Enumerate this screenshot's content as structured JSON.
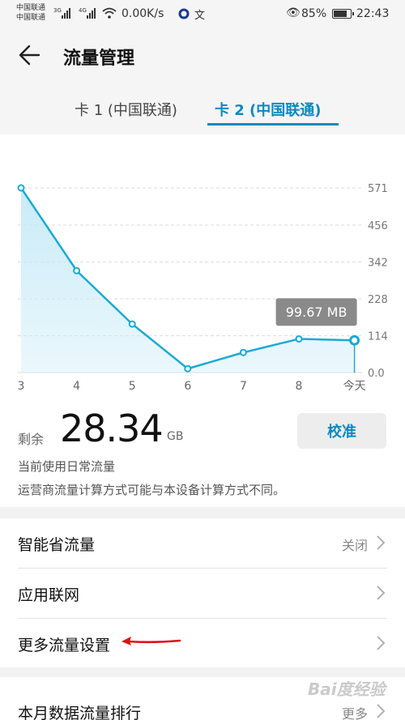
{
  "status_bar": {
    "carrier1": "中国联通",
    "carrier2": "中国联通",
    "sig1": "3G",
    "sig2": "4G",
    "speed": "0.00K/s",
    "extra": "文",
    "battery": "85%",
    "battery_level": 0.85,
    "time": "22:43"
  },
  "header": {
    "title": "流量管理",
    "tabs": [
      {
        "label": "卡 1 (中国联通)",
        "active": false
      },
      {
        "label": "卡 2 (中国联通)",
        "active": true
      }
    ]
  },
  "chart_data": {
    "type": "area",
    "categories": [
      "3",
      "4",
      "5",
      "6",
      "7",
      "8",
      "今天"
    ],
    "values": [
      571,
      315,
      150,
      12,
      62,
      104,
      99.67
    ],
    "ylim": [
      0,
      571
    ],
    "yticks": [
      "0.0",
      "114",
      "228",
      "342",
      "456",
      "571"
    ],
    "tooltip": "99.67 MB",
    "color": "#1aaad6",
    "fill": "#c6eaf7"
  },
  "summary": {
    "remaining_label": "剩余",
    "remaining_value": "28.34",
    "remaining_unit": "GB",
    "calibrate_label": "校准",
    "note1": "当前使用日常流量",
    "note2": "运营商流量计算方式可能与本设备计算方式不同。"
  },
  "settings": {
    "smart_saver": {
      "label": "智能省流量",
      "value": "关闭"
    },
    "app_network": {
      "label": "应用联网"
    },
    "more_settings": {
      "label": "更多流量设置"
    },
    "ranking": {
      "label": "本月数据流量排行",
      "value": "更多"
    }
  },
  "watermark": "Bai度经验"
}
